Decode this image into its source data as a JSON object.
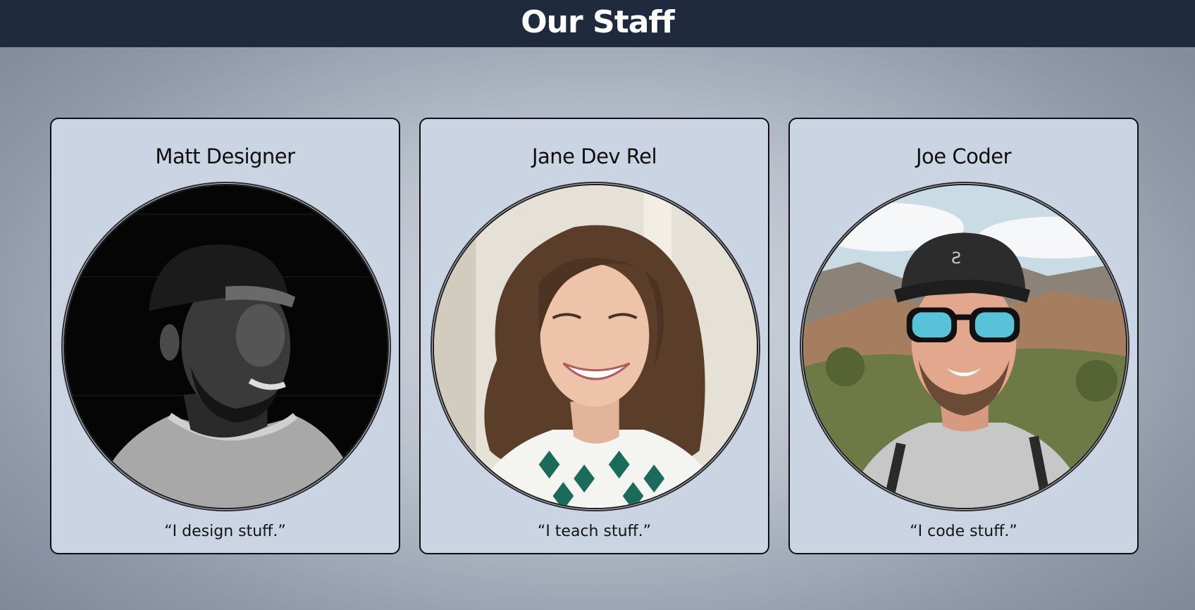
{
  "header": {
    "title": "Our Staff"
  },
  "staff": [
    {
      "name": "Matt Designer",
      "quote": "“I design stuff.”",
      "photo_icon": "person-portrait-bw"
    },
    {
      "name": "Jane Dev Rel",
      "quote": "“I teach stuff.”",
      "photo_icon": "person-portrait-woman"
    },
    {
      "name": "Joe Coder",
      "quote": "“I code stuff.”",
      "photo_icon": "person-portrait-cap-sunglasses"
    }
  ],
  "colors": {
    "header_bg": "#1f2a3d",
    "card_bg": "#cbd4e2",
    "text": "#0e0e0e"
  }
}
